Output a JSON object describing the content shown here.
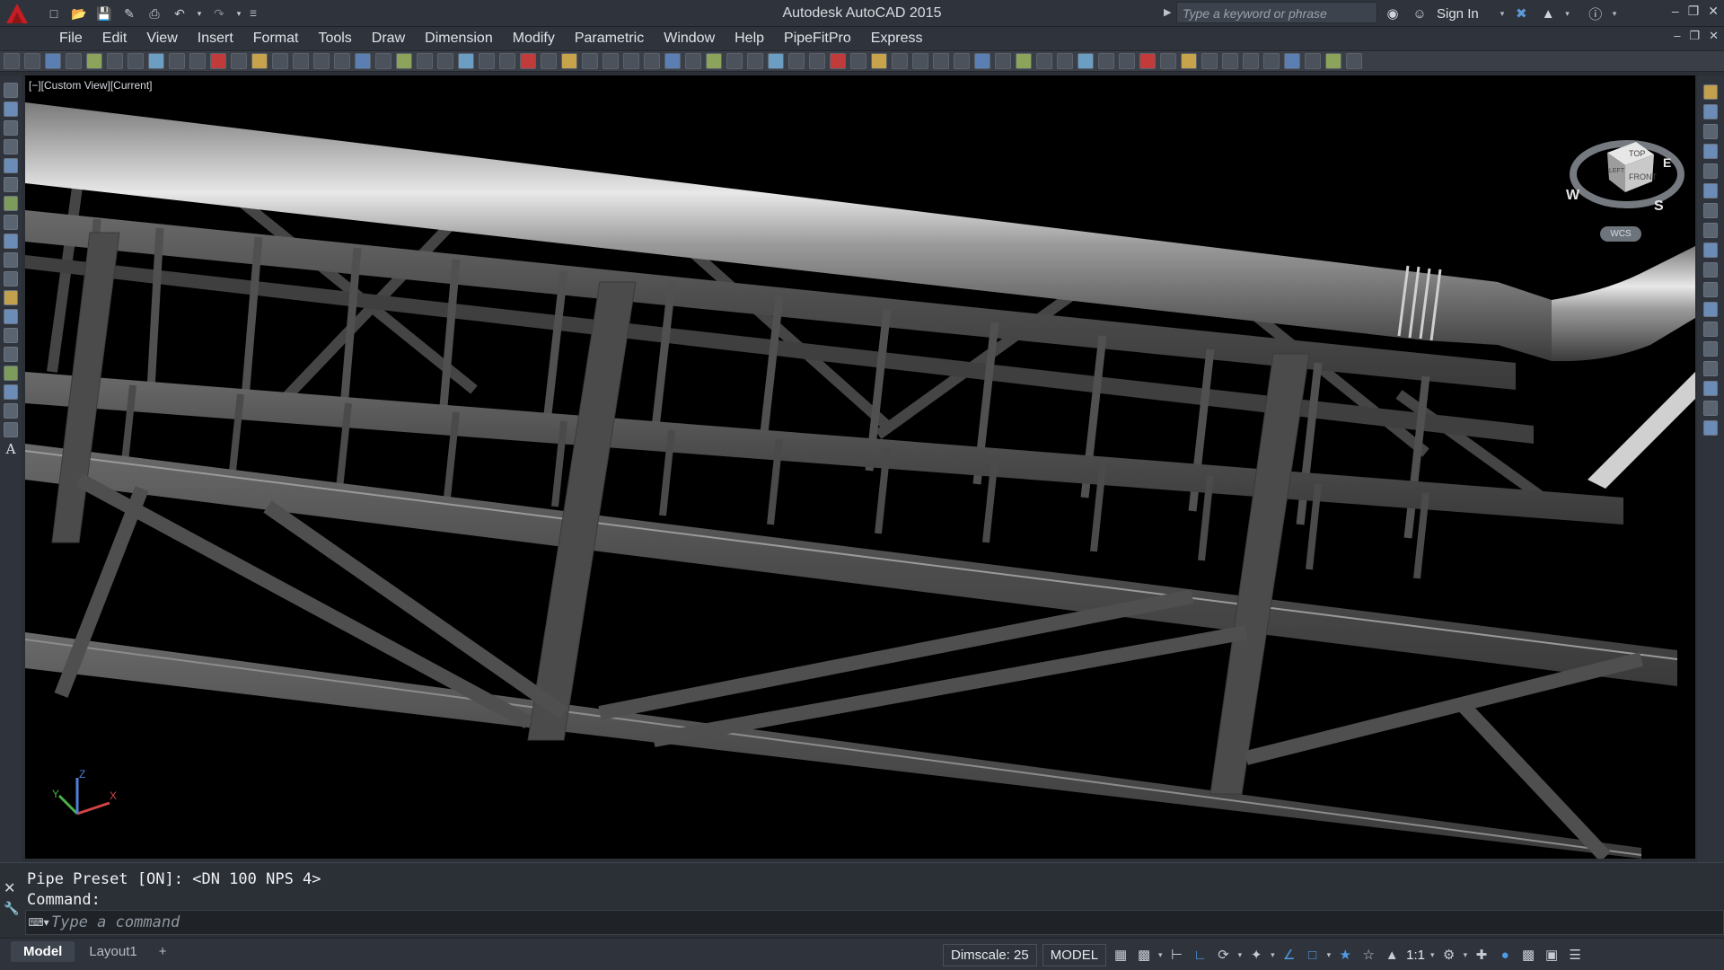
{
  "title_bar": {
    "app_title": "Autodesk AutoCAD 2015",
    "search_placeholder": "Type a keyword or phrase",
    "signin_label": "Sign In"
  },
  "menu": {
    "items": [
      "File",
      "Edit",
      "View",
      "Insert",
      "Format",
      "Tools",
      "Draw",
      "Dimension",
      "Modify",
      "Parametric",
      "Window",
      "Help",
      "PipeFitPro",
      "Express"
    ]
  },
  "viewport": {
    "label": "[−][Custom View][Current]",
    "viewcube": {
      "top": "TOP",
      "front": "FRONT",
      "left": "LEFT",
      "compass": [
        "W",
        "S",
        "E"
      ]
    },
    "wcs": "WCS",
    "ucs_axes": [
      "X",
      "Y",
      "Z"
    ]
  },
  "command": {
    "history": [
      "Pipe Preset [ON]: <DN 100 NPS 4>",
      "Command:"
    ],
    "input_placeholder": "Type a command"
  },
  "status_bar": {
    "tabs": [
      "Model",
      "Layout1",
      "+"
    ],
    "dimscale": "Dimscale: 25",
    "model_label": "MODEL",
    "annotation_scale": "1:1"
  },
  "colors": {
    "background_chrome": "#2f343c",
    "viewport_background": "#000000",
    "steel_gray": "#4d4d4d",
    "pipe_highlight": "#e8e8e8",
    "accent_blue": "#4f9be6",
    "logo_red": "#c51d23"
  },
  "icons": {
    "quick_access": [
      "new-icon",
      "open-icon",
      "save-icon",
      "save-as-icon",
      "print-icon",
      "undo-icon",
      "redo-icon",
      "customize-icon"
    ],
    "title_right": [
      "binoculars-icon",
      "user-icon",
      "exchange-icon",
      "a360-icon",
      "help-icon"
    ]
  }
}
